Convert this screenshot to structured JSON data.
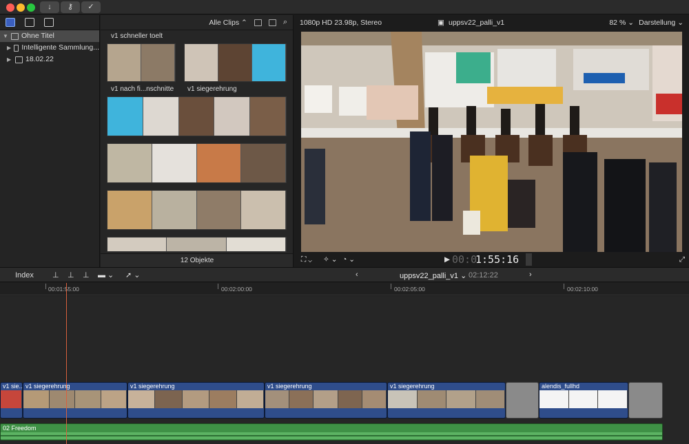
{
  "toolbar": {
    "import_icon": "down-arrow-icon",
    "keyword_icon": "key-icon",
    "check_icon": "checkmark-icon"
  },
  "library": {
    "items": [
      {
        "label": "Ohne Titel",
        "selected": true,
        "expanded": true,
        "indent": 0
      },
      {
        "label": "Intelligente Sammlung...",
        "selected": false,
        "expanded": false,
        "indent": 1
      },
      {
        "label": "18.02.22",
        "selected": false,
        "expanded": false,
        "indent": 1
      }
    ]
  },
  "browser": {
    "filter_label": "Alle Clips",
    "clip_labels": [
      "v1 schneller toelt",
      "v1 nach fi...nschnitte",
      "v1 siegerehrung"
    ],
    "object_count": "12 Objekte"
  },
  "viewer": {
    "format": "1080p HD 23.98p, Stereo",
    "project_name": "uppsv22_palli_v1",
    "zoom": "82 %",
    "view_menu": "Darstellung",
    "timecode_dim": "00:0",
    "timecode": "1:55:16"
  },
  "timeline": {
    "index_label": "Index",
    "project_name": "uppsv22_palli_v1",
    "duration": "02:12:22",
    "ruler_ticks": [
      "00:01:55:00",
      "00:02:00:00",
      "00:02:05:00",
      "00:02:10:00"
    ],
    "clips": [
      {
        "label": "v1 sie..."
      },
      {
        "label": "v1 siegerehrung"
      },
      {
        "label": "v1 siegerehrung"
      },
      {
        "label": "v1 siegerehrung"
      },
      {
        "label": "v1 siegerehrung"
      },
      {
        "label": "alendis_fullhd"
      }
    ],
    "audio_label": "02 Freedom"
  },
  "colors": {
    "accent": "#2f4d8b",
    "audio": "#3f9146",
    "playhead": "#d9603d"
  }
}
